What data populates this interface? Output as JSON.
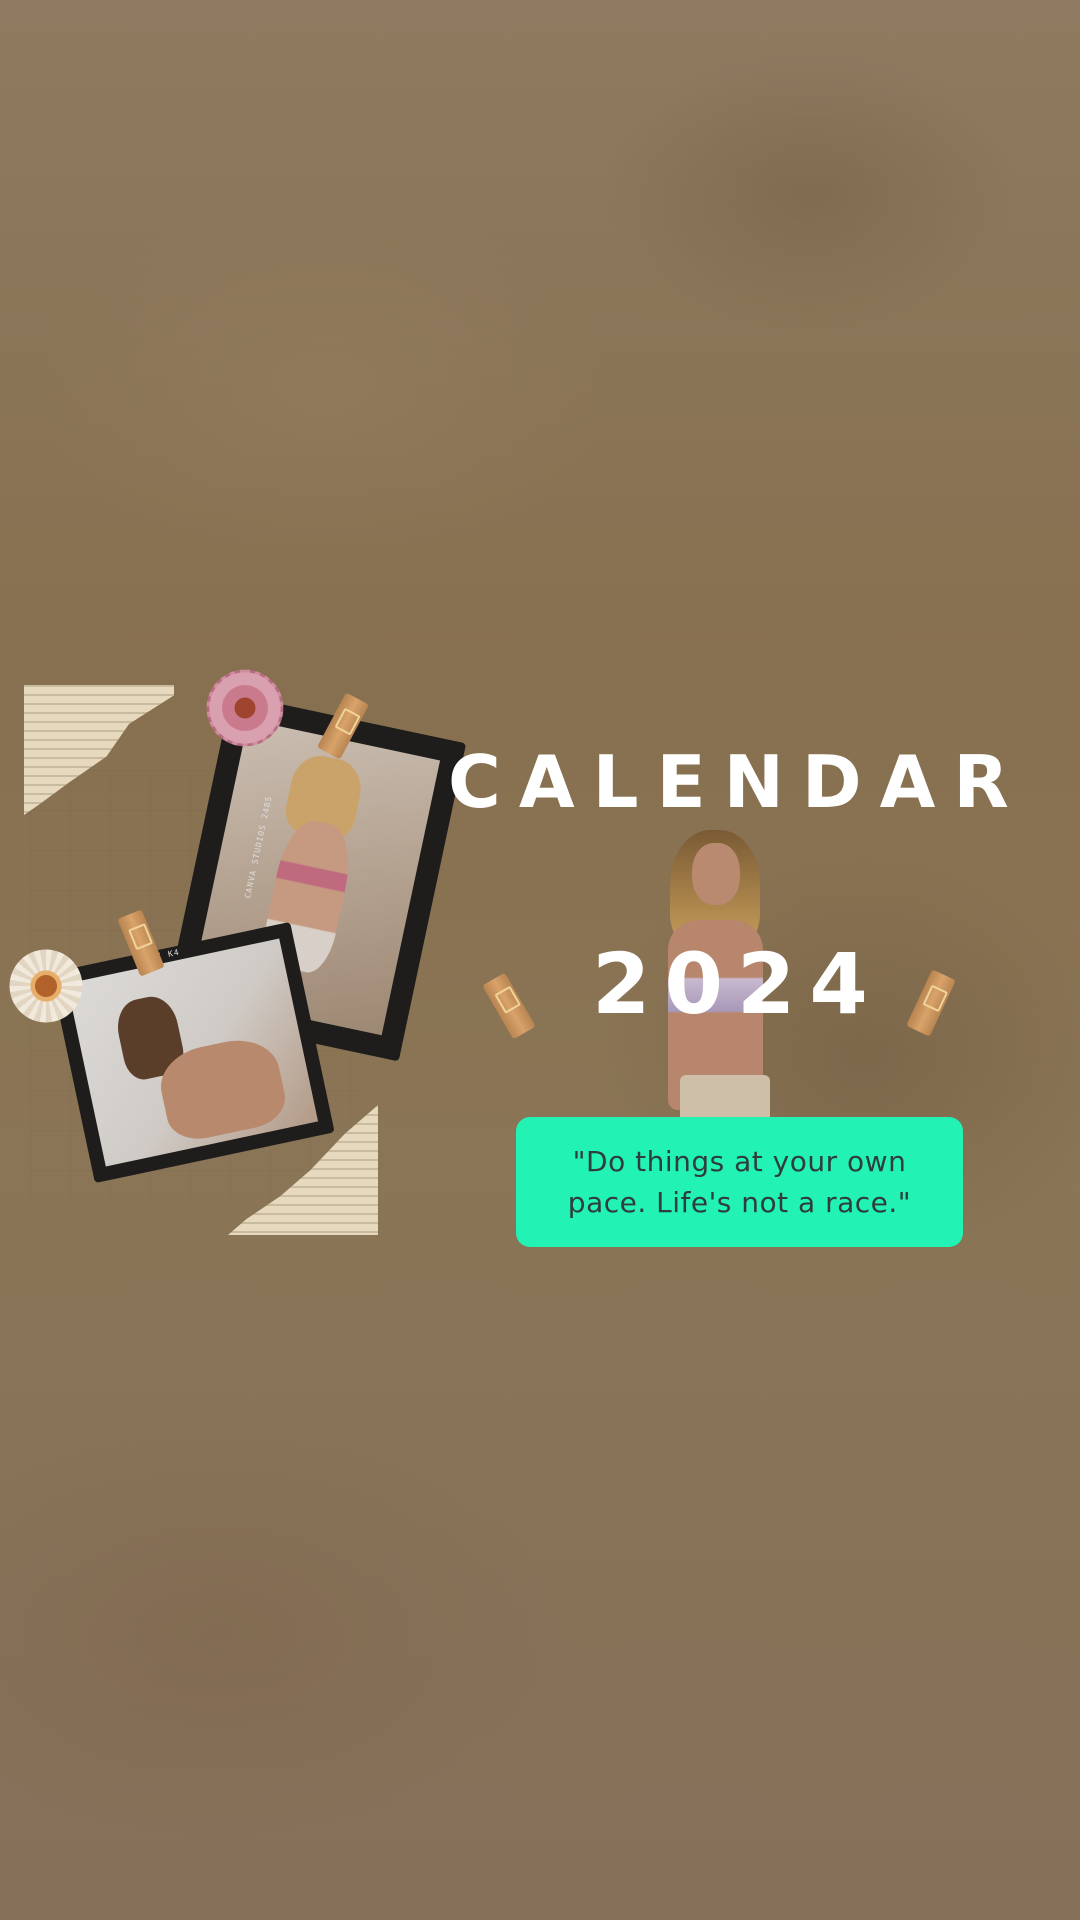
{
  "page": {
    "background_color": "#8a7357",
    "accent_color": "#22f2b3"
  },
  "header": {
    "title": "CALENDAR",
    "year": "2024"
  },
  "quote": {
    "text": "\"Do things at your own\npace. Life's not a race.\""
  },
  "decorations": {
    "frame_back_label": "CANVA STUDIOS 2485",
    "frame_front_label": "FUJI K4"
  }
}
